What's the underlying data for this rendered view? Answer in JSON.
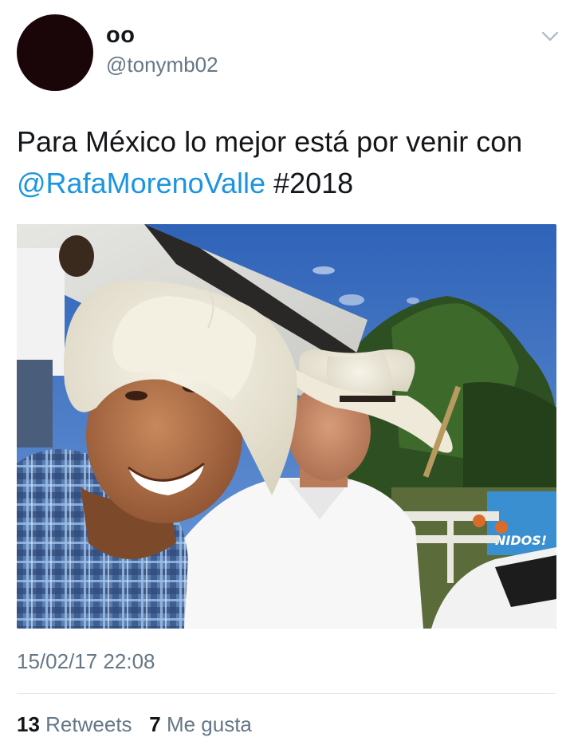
{
  "user": {
    "display_name": "oo",
    "handle": "@tonymb02"
  },
  "tweet": {
    "text_before": "Para México lo mejor está por venir con",
    "mention": "@RafaMorenoValle",
    "hashtag": "#2018",
    "timestamp": "15/02/17 22:08"
  },
  "stats": {
    "retweets_count": "13",
    "retweets_label": "Retweets",
    "likes_count": "7",
    "likes_label": "Me gusta"
  },
  "photo": {
    "banner_text": "NIDOS!"
  },
  "icons": {
    "menu": "chevron-down-icon"
  },
  "colors": {
    "link": "#1b95e0",
    "secondary_text": "#657786",
    "primary_text": "#14171a",
    "divider": "#e1e8ed",
    "avatar": "#1a0508"
  }
}
